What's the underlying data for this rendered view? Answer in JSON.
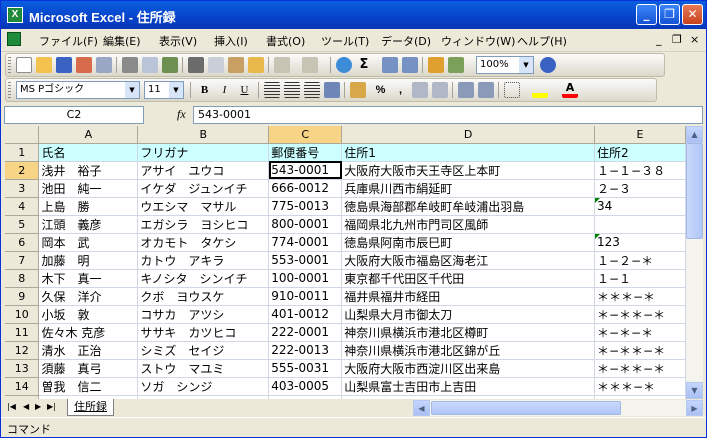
{
  "window": {
    "title": "Microsoft Excel - 住所録",
    "app_icon_glyph": "X",
    "minimize_glyph": "_",
    "restore_glyph": "❐",
    "close_glyph": "✕"
  },
  "menu": {
    "items": [
      "ファイル(F)",
      "編集(E)",
      "表示(V)",
      "挿入(I)",
      "書式(O)",
      "ツール(T)",
      "データ(D)",
      "ウィンドウ(W)",
      "ヘルプ(H)"
    ],
    "mdi_min": "_",
    "mdi_restore": "❐",
    "mdi_close": "×"
  },
  "toolbar": {
    "zoom": "100%",
    "font_name": "MS Pゴシック",
    "font_size": "11",
    "bold": "B",
    "italic": "I",
    "underline": "U",
    "percent": "%",
    "comma": ","
  },
  "formula_bar": {
    "cell_ref": "C2",
    "fx": "fx",
    "content": "543-0001"
  },
  "grid": {
    "columns": [
      "A",
      "B",
      "C",
      "D",
      "E"
    ],
    "active_column": "C",
    "active_row": "2",
    "rows": [
      {
        "num": "1",
        "cells": [
          "氏名",
          "フリガナ",
          "郵便番号",
          "住所1",
          "住所2"
        ]
      },
      {
        "num": "2",
        "cells": [
          "浅井　裕子",
          "アサイ　ユウコ",
          "543-0001",
          "大阪府大阪市天王寺区上本町",
          "１−１−３８"
        ]
      },
      {
        "num": "3",
        "cells": [
          "池田　純一",
          "イケダ　ジュンイチ",
          "666-0012",
          "兵庫県川西市絹延町",
          "２−３"
        ]
      },
      {
        "num": "4",
        "cells": [
          "上島　勝",
          "ウエシマ　マサル",
          "775-0013",
          "徳島県海部郡牟岐町牟岐浦出羽島",
          "34"
        ]
      },
      {
        "num": "5",
        "cells": [
          "江頭　義彦",
          "エガシラ　ヨシヒコ",
          "800-0001",
          "福岡県北九州市門司区風師",
          ""
        ]
      },
      {
        "num": "6",
        "cells": [
          "岡本　武",
          "オカモト　タケシ",
          "774-0001",
          "徳島県阿南市辰巳町",
          "123"
        ]
      },
      {
        "num": "7",
        "cells": [
          "加藤　明",
          "カトウ　アキラ",
          "553-0001",
          "大阪府大阪市福島区海老江",
          "１−２−＊"
        ]
      },
      {
        "num": "8",
        "cells": [
          "木下　真一",
          "キノシタ　シンイチ",
          "100-0001",
          "東京都千代田区千代田",
          "１−１"
        ]
      },
      {
        "num": "9",
        "cells": [
          "久保　洋介",
          "クボ　ヨウスケ",
          "910-0011",
          "福井県福井市経田",
          "＊＊＊−＊"
        ]
      },
      {
        "num": "10",
        "cells": [
          "小坂　敦",
          "コサカ　アツシ",
          "401-0012",
          "山梨県大月市御太刀",
          "＊−＊＊−＊"
        ]
      },
      {
        "num": "11",
        "cells": [
          "佐々木 克彦",
          "ササキ　カツヒコ",
          "222-0001",
          "神奈川県横浜市港北区樽町",
          "＊−＊−＊"
        ]
      },
      {
        "num": "12",
        "cells": [
          "清水　正治",
          "シミズ　セイジ",
          "222-0013",
          "神奈川県横浜市港北区錦が丘",
          "＊−＊＊−＊"
        ]
      },
      {
        "num": "13",
        "cells": [
          "須藤　真弓",
          "ストウ　マユミ",
          "555-0031",
          "大阪府大阪市西淀川区出来島",
          "＊−＊＊−＊"
        ]
      },
      {
        "num": "14",
        "cells": [
          "曽我　信二",
          "ソガ　シンジ",
          "403-0005",
          "山梨県富士吉田市上吉田",
          "＊＊＊−＊"
        ]
      },
      {
        "num": "15",
        "cells": [
          "",
          "",
          "",
          "",
          ""
        ]
      }
    ]
  },
  "sheets": {
    "nav": [
      "|◀",
      "◀",
      "▶",
      "▶|"
    ],
    "active_tab": "住所録"
  },
  "status": {
    "mode": "コマンド"
  }
}
